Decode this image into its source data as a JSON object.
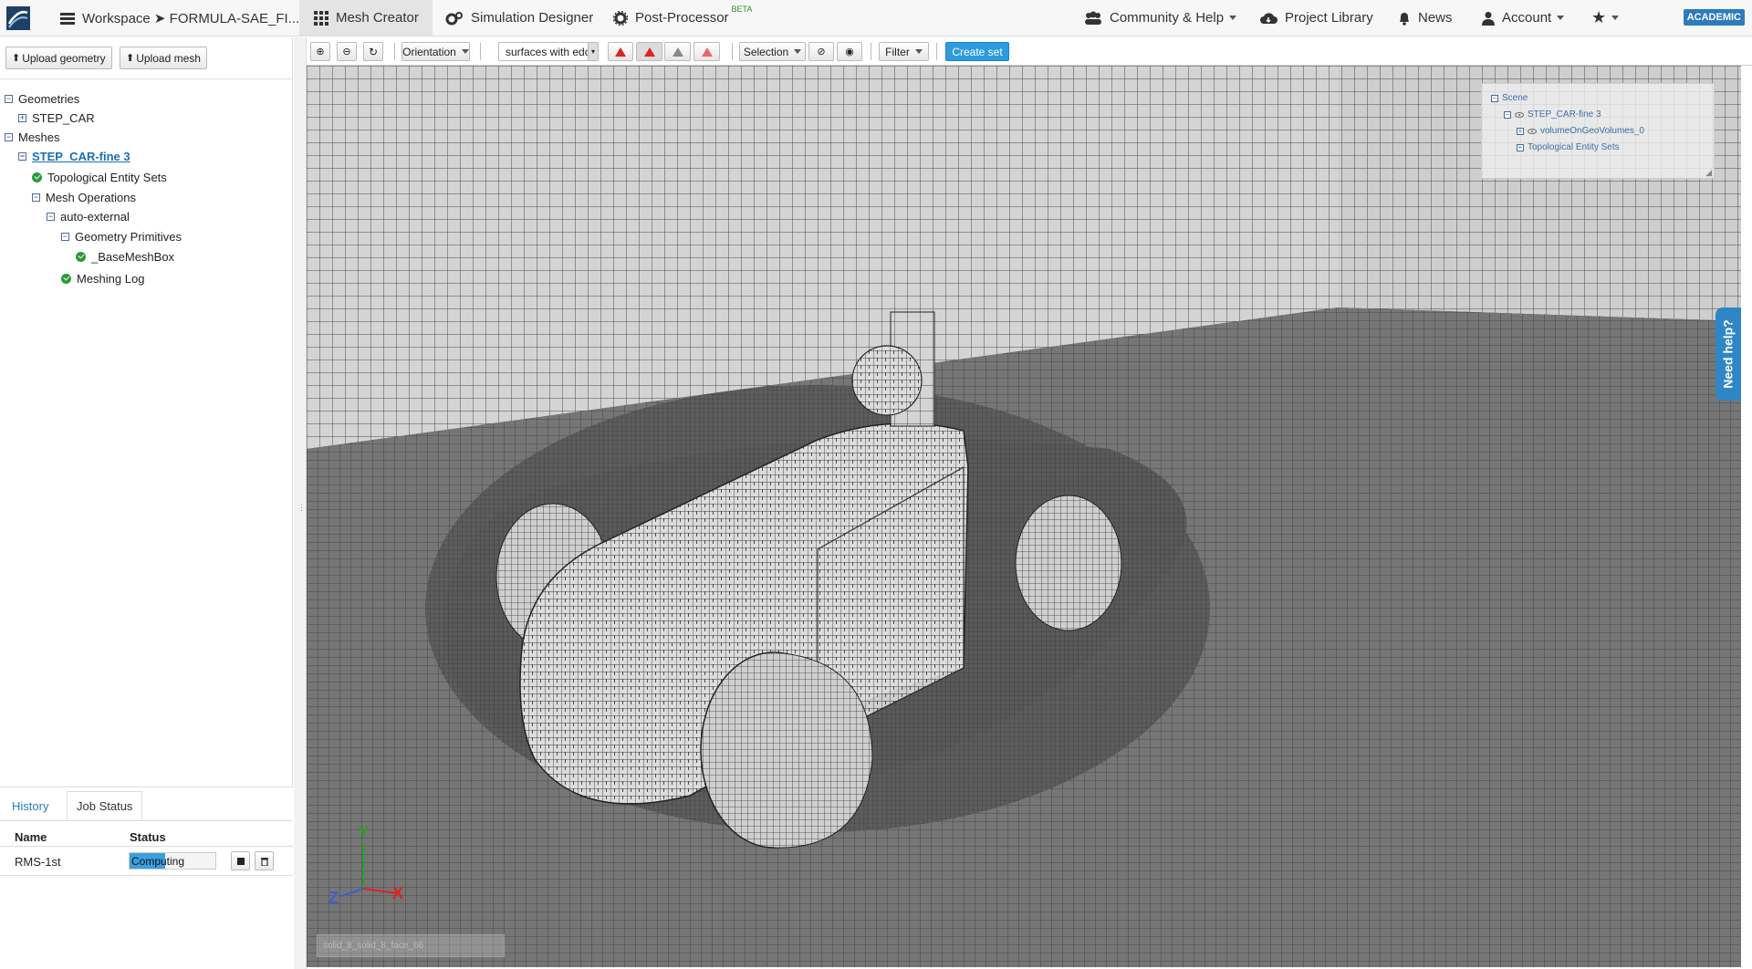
{
  "topbar": {
    "workspace_label": "Workspace ➤ FORMULA-SAE_FI...",
    "mesh_creator": "Mesh Creator",
    "simulation_designer": "Simulation Designer",
    "post_processor": "Post-Processor",
    "post_processor_badge": "BETA",
    "community_help": "Community & Help",
    "project_library": "Project Library",
    "news": "News",
    "account": "Account",
    "academic_badge": "ACADEMIC"
  },
  "sidebar": {
    "upload_geometry": "Upload geometry",
    "upload_mesh": "Upload mesh",
    "tree": {
      "geometries": "Geometries",
      "step_car": "STEP_CAR",
      "meshes": "Meshes",
      "mesh_name": "STEP_CAR-fine 3",
      "topological_sets": "Topological Entity Sets",
      "mesh_operations": "Mesh Operations",
      "auto_external": "auto-external",
      "geometry_primitives": "Geometry Primitives",
      "base_mesh_box": "_BaseMeshBox",
      "meshing_log": "Meshing Log"
    }
  },
  "bottom_panel": {
    "tabs": [
      "History",
      "Job Status"
    ],
    "columns": [
      "Name",
      "Status"
    ],
    "jobs": [
      {
        "name": "RMS-1st",
        "status": "Computing",
        "progress": 0.42
      }
    ]
  },
  "toolbar": {
    "orientation": "Orientation",
    "render_mode": "surfaces with edo",
    "selection": "Selection",
    "filter": "Filter",
    "create_set": "Create set"
  },
  "viewport": {
    "scene_tree": {
      "scene": "Scene",
      "mesh": "STEP_CAR-fine 3",
      "volume": "volumeOnGeoVolumes_0",
      "topo": "Topological Entity Sets"
    },
    "need_help": "Need help?",
    "axis_labels": {
      "x": "X",
      "y": "Y",
      "z": "Z"
    },
    "status_text": "solid_8_solid_8_face_66"
  }
}
